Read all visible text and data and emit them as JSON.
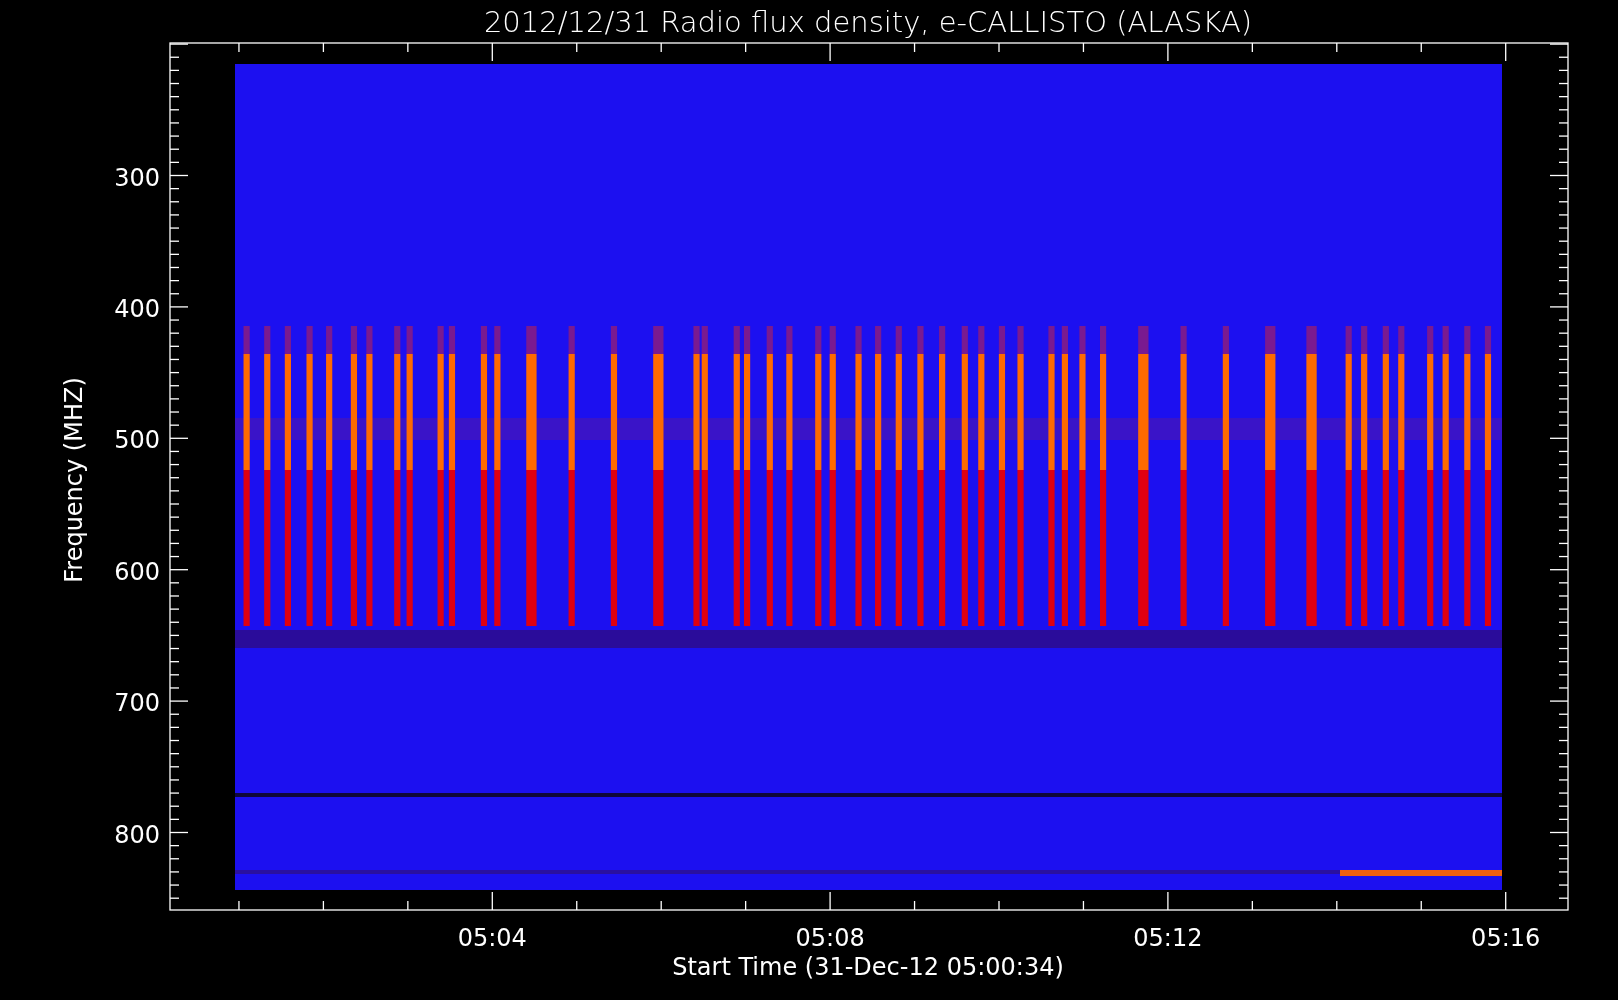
{
  "chart": {
    "title": "2012/12/31  Radio flux density, e-CALLISTO (ALASKA)",
    "ylabel": "Frequency (MHZ)",
    "xlabel": "Start Time (31-Dec-12 05:00:34)",
    "yticks": [
      "300",
      "400",
      "500",
      "600",
      "700",
      "800"
    ],
    "xticks": [
      "05:04",
      "05:08",
      "05:12",
      "05:16"
    ]
  }
}
